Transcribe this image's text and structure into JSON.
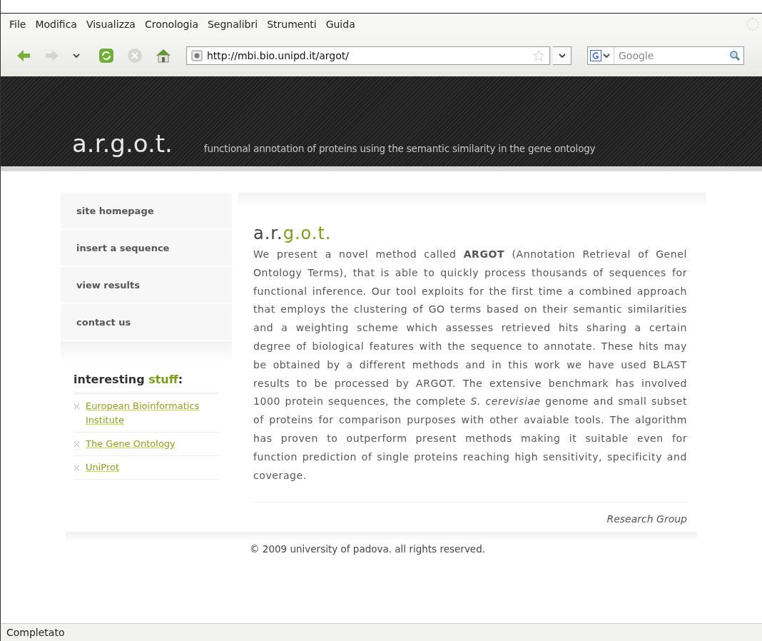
{
  "menu": [
    {
      "label": "File"
    },
    {
      "label": "Modifica"
    },
    {
      "label": "Visualizza"
    },
    {
      "label": "Cronologia"
    },
    {
      "label": "Segnalibri"
    },
    {
      "label": "Strumenti"
    },
    {
      "label": "Guida"
    }
  ],
  "toolbar": {
    "buttons": [
      {
        "kind": "back",
        "disabled": false
      },
      {
        "kind": "forward",
        "disabled": true
      },
      {
        "kind": "history",
        "disabled": false
      },
      {
        "kind": "reload",
        "disabled": false
      },
      {
        "kind": "stop",
        "disabled": true
      },
      {
        "kind": "home",
        "disabled": false
      }
    ],
    "url": "http://mbi.bio.unipd.it/argot/",
    "search": {
      "placeholder": "Google"
    }
  },
  "header": {
    "logo": "a.r.g.o.t.",
    "tagline": "functional annotation of proteins using the semantic similarity in the gene ontology"
  },
  "sidebar": {
    "items": [
      {
        "label": "site homepage"
      },
      {
        "label": "insert a sequence"
      },
      {
        "label": "view results"
      },
      {
        "label": "contact us"
      }
    ],
    "heading": {
      "lead": "interesting",
      "accent": "stuff",
      "tail": ":"
    },
    "links": [
      {
        "label": "European Bioinformatics Institute"
      },
      {
        "label": "The Gene Ontology"
      },
      {
        "label": "UniProt"
      }
    ]
  },
  "main": {
    "title": {
      "lead": "a.r.",
      "accent": "g.o.t."
    },
    "paragraph": "We present a novel method called **ARGOT** (Annotation Retrieval of Genel Ontology Terms), that is able to quickly process thousands of sequences for functional inference. Our tool exploits for the first time a combined approach that employs the clustering of GO terms based on their semantic similarities and a weighting scheme which assesses retrieved hits sharing a certain degree of biological features with the sequence to annotate. These hits may be obtained by a different methods and in this work we have used BLAST results to be processed by ARGOT. The extensive benchmark has involved 1000 protein sequences, the complete *S. cerevisiae* genome and small subset of proteins for comparison purposes with other avaiable tools. The algorithm has proven to outperform present methods making it suitable even for function prediction of single proteins reaching high sensitivity, specificity and coverage.",
    "signature": "Research Group"
  },
  "footer": "© 2009 university of padova. all rights reserved.",
  "status_bar": "Completato"
}
